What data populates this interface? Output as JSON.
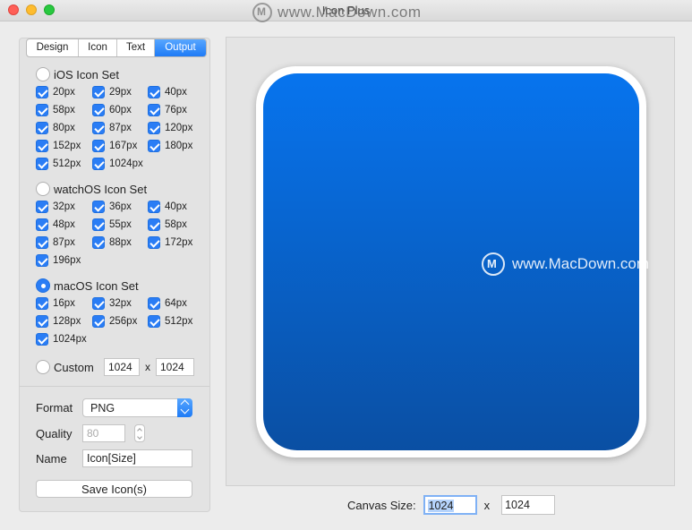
{
  "window": {
    "title": "Icon Plus"
  },
  "watermark": {
    "text": "www.MacDown.com"
  },
  "tabs": [
    {
      "label": "Design",
      "active": false
    },
    {
      "label": "Icon",
      "active": false
    },
    {
      "label": "Text",
      "active": false
    },
    {
      "label": "Output",
      "active": true
    }
  ],
  "ios": {
    "label": "iOS Icon Set",
    "selected": false,
    "sizes": [
      "20px",
      "29px",
      "40px",
      "58px",
      "60px",
      "76px",
      "80px",
      "87px",
      "120px",
      "152px",
      "167px",
      "180px",
      "512px",
      "1024px"
    ]
  },
  "watchos": {
    "label": "watchOS Icon Set",
    "selected": false,
    "sizes": [
      "32px",
      "36px",
      "40px",
      "48px",
      "55px",
      "58px",
      "87px",
      "88px",
      "172px",
      "196px"
    ]
  },
  "macos": {
    "label": "macOS Icon Set",
    "selected": true,
    "sizes": [
      "16px",
      "32px",
      "64px",
      "128px",
      "256px",
      "512px",
      "1024px"
    ]
  },
  "custom": {
    "label": "Custom",
    "selected": false,
    "width": "1024",
    "separator": "x",
    "height": "1024"
  },
  "format": {
    "label": "Format",
    "value": "PNG"
  },
  "quality": {
    "label": "Quality",
    "value": "80"
  },
  "name": {
    "label": "Name",
    "value": "Icon[Size]"
  },
  "save_button": {
    "label": "Save Icon(s)"
  },
  "canvas": {
    "label": "Canvas Size:",
    "width": "1024",
    "separator": "x",
    "height": "1024"
  },
  "colors": {
    "accent": "#2a7df5",
    "icon_top": "#0774ee",
    "icon_bottom": "#0a4fa3"
  }
}
